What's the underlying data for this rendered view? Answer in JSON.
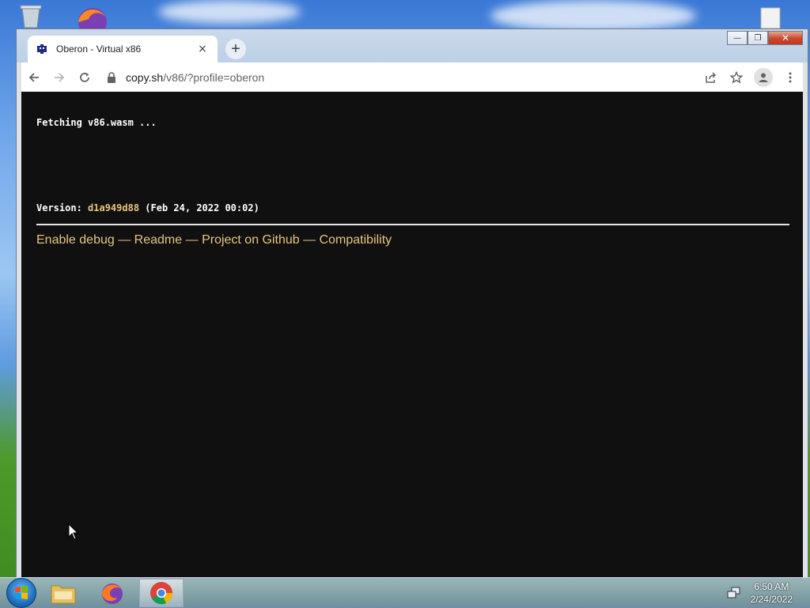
{
  "browser": {
    "tab_title": "Oberon - Virtual x86",
    "tab_close": "×",
    "new_tab": "+",
    "url_host": "copy.sh",
    "url_path": "/v86/?profile=oberon",
    "window_controls": {
      "minimize": "—",
      "restore": "❐",
      "close": "✕"
    }
  },
  "page": {
    "status": "Fetching v86.wasm ...",
    "version_label": "Version:",
    "version_hash": "d1a949d88",
    "version_date": "(Feb 24, 2022 00:02)",
    "links": [
      "Enable debug",
      "Readme",
      "Project on Github",
      "Compatibility"
    ],
    "link_separator": "—"
  },
  "taskbar": {
    "items": [
      "start",
      "file-explorer",
      "firefox",
      "chrome"
    ],
    "active": "chrome",
    "time": "6:50 AM",
    "date": "2/24/2022"
  },
  "colors": {
    "page_background": "#101010",
    "link_color": "#e8c57f",
    "text_color": "#ffffff"
  }
}
